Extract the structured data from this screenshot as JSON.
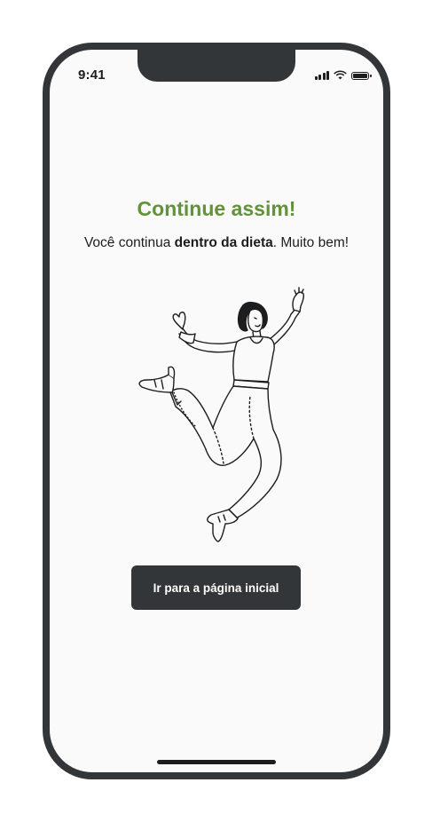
{
  "status_bar": {
    "time": "9:41",
    "icons": [
      "signal-icon",
      "wifi-icon",
      "battery-icon"
    ]
  },
  "feedback": {
    "title": "Continue assim!",
    "subtitle_prefix": "Você continua ",
    "subtitle_bold": "dentro da dieta",
    "subtitle_suffix": ". Muito bem!",
    "illustration": "jumping-woman-illustration"
  },
  "actions": {
    "home_button_label": "Ir para a página inicial"
  },
  "colors": {
    "title_green": "#639339",
    "dark": "#333638",
    "background": "#FAFAFA"
  }
}
